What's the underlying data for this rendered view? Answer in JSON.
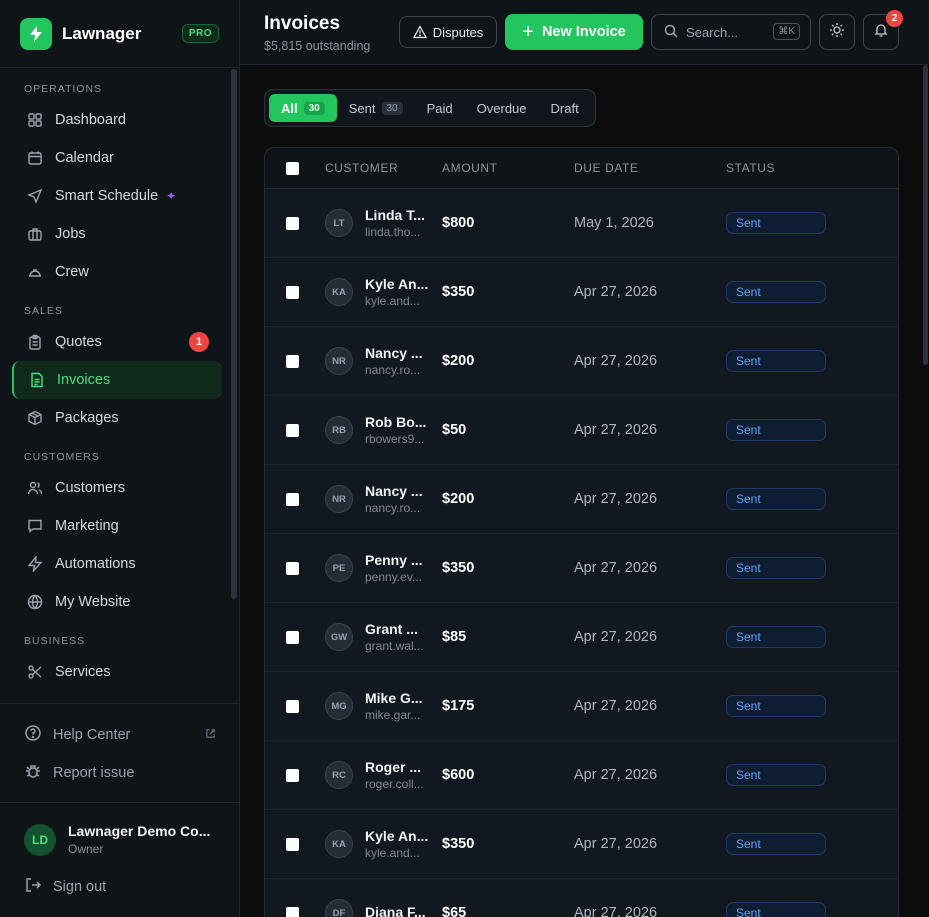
{
  "brand": {
    "name": "Lawnager",
    "badge": "PRO"
  },
  "sidebar": {
    "sections": [
      {
        "label": "OPERATIONS",
        "items": [
          {
            "label": "Dashboard",
            "icon": "grid-icon"
          },
          {
            "label": "Calendar",
            "icon": "calendar-icon"
          },
          {
            "label": "Smart Schedule",
            "icon": "send-icon",
            "extra": "sparkle-icon"
          },
          {
            "label": "Jobs",
            "icon": "briefcase-icon"
          },
          {
            "label": "Crew",
            "icon": "hard-hat-icon"
          }
        ]
      },
      {
        "label": "SALES",
        "items": [
          {
            "label": "Quotes",
            "icon": "clipboard-icon",
            "count": "1"
          },
          {
            "label": "Invoices",
            "icon": "file-text-icon",
            "active": true
          },
          {
            "label": "Packages",
            "icon": "package-icon"
          }
        ]
      },
      {
        "label": "CUSTOMERS",
        "items": [
          {
            "label": "Customers",
            "icon": "users-icon"
          },
          {
            "label": "Marketing",
            "icon": "message-icon"
          },
          {
            "label": "Automations",
            "icon": "zap-icon"
          },
          {
            "label": "My Website",
            "icon": "globe-icon"
          }
        ]
      },
      {
        "label": "BUSINESS",
        "items": [
          {
            "label": "Services",
            "icon": "scissors-icon"
          }
        ]
      }
    ],
    "footer": {
      "help": "Help Center",
      "report": "Report issue",
      "user_name": "Lawnager Demo Co...",
      "user_role": "Owner",
      "user_initials": "LD",
      "signout": "Sign out"
    }
  },
  "header": {
    "title": "Invoices",
    "subtitle": "$5,815 outstanding",
    "disputes_label": "Disputes",
    "new_invoice_label": "New Invoice",
    "search_placeholder": "Search...",
    "search_shortcut": "⌘K",
    "notifications_count": "2"
  },
  "tabs": [
    {
      "label": "All",
      "count": "30",
      "active": true
    },
    {
      "label": "Sent",
      "count": "30"
    },
    {
      "label": "Paid"
    },
    {
      "label": "Overdue"
    },
    {
      "label": "Draft"
    }
  ],
  "table": {
    "columns": [
      "CUSTOMER",
      "AMOUNT",
      "DUE DATE",
      "STATUS"
    ],
    "rows": [
      {
        "initials": "LT",
        "name": "Linda T...",
        "email": "linda.tho...",
        "amount": "$800",
        "due": "May 1, 2026",
        "status": "Sent"
      },
      {
        "initials": "KA",
        "name": "Kyle An...",
        "email": "kyle.and...",
        "amount": "$350",
        "due": "Apr 27, 2026",
        "status": "Sent"
      },
      {
        "initials": "NR",
        "name": "Nancy ...",
        "email": "nancy.ro...",
        "amount": "$200",
        "due": "Apr 27, 2026",
        "status": "Sent"
      },
      {
        "initials": "RB",
        "name": "Rob Bo...",
        "email": "rbowers9...",
        "amount": "$50",
        "due": "Apr 27, 2026",
        "status": "Sent"
      },
      {
        "initials": "NR",
        "name": "Nancy ...",
        "email": "nancy.ro...",
        "amount": "$200",
        "due": "Apr 27, 2026",
        "status": "Sent"
      },
      {
        "initials": "PE",
        "name": "Penny ...",
        "email": "penny.ev...",
        "amount": "$350",
        "due": "Apr 27, 2026",
        "status": "Sent"
      },
      {
        "initials": "GW",
        "name": "Grant ...",
        "email": "grant.wal...",
        "amount": "$85",
        "due": "Apr 27, 2026",
        "status": "Sent"
      },
      {
        "initials": "MG",
        "name": "Mike G...",
        "email": "mike.gar...",
        "amount": "$175",
        "due": "Apr 27, 2026",
        "status": "Sent"
      },
      {
        "initials": "RC",
        "name": "Roger ...",
        "email": "roger.coll...",
        "amount": "$600",
        "due": "Apr 27, 2026",
        "status": "Sent"
      },
      {
        "initials": "KA",
        "name": "Kyle An...",
        "email": "kyle.and...",
        "amount": "$350",
        "due": "Apr 27, 2026",
        "status": "Sent"
      },
      {
        "initials": "DF",
        "name": "Diana F...",
        "email": "",
        "amount": "$65",
        "due": "Apr 27, 2026",
        "status": "Sent"
      }
    ]
  },
  "colors": {
    "accent": "#22c55e",
    "badge": "#ef4444",
    "status_sent": "#60a5fa"
  }
}
